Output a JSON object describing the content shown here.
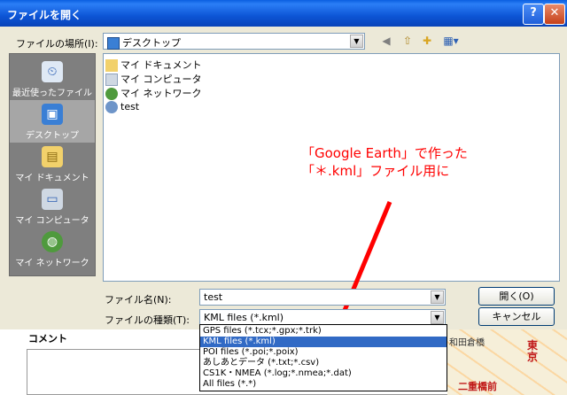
{
  "window": {
    "title": "ファイルを開く",
    "help": "?",
    "close": "✕"
  },
  "lookin": {
    "label": "ファイルの場所(I):",
    "value": "デスクトップ"
  },
  "places": [
    {
      "label": "最近使ったファイル",
      "icon": "recent-documents-icon"
    },
    {
      "label": "デスクトップ",
      "icon": "desktop-icon"
    },
    {
      "label": "マイ ドキュメント",
      "icon": "my-documents-icon"
    },
    {
      "label": "マイ コンピュータ",
      "icon": "my-computer-icon"
    },
    {
      "label": "マイ ネットワーク",
      "icon": "my-network-icon"
    }
  ],
  "files": [
    {
      "name": "マイ ドキュメント",
      "icon": "folder-icon"
    },
    {
      "name": "マイ コンピュータ",
      "icon": "computer-icon"
    },
    {
      "name": "マイ ネットワーク",
      "icon": "network-icon"
    },
    {
      "name": "test",
      "icon": "globe-file-icon"
    }
  ],
  "annotation": {
    "line1": "「Google Earth」で作った",
    "line2": "「＊.kml」ファイル用に"
  },
  "filename": {
    "label": "ファイル名(N):",
    "value": "test"
  },
  "filetype": {
    "label": "ファイルの種類(T):",
    "value": "KML files (*.kml)",
    "options": [
      "GPS files (*.tcx;*.gpx;*.trk)",
      "KML files (*.kml)",
      "POI files (*.poi;*.poix)",
      "あしあとデータ (*.txt;*.csv)",
      "CS1K・NMEA (*.log;*.nmea;*.dat)",
      "All files (*.*)"
    ],
    "selected_index": 1
  },
  "buttons": {
    "open": "開く(O)",
    "cancel": "キャンセル"
  },
  "background": {
    "comment": "コメント",
    "map1": "和田倉橋",
    "map2": "東京",
    "map3": "二重橋前"
  },
  "colors": {
    "annotation": "#ff0000",
    "selection": "#316ac5",
    "titlebar": "#0a5fe0"
  }
}
